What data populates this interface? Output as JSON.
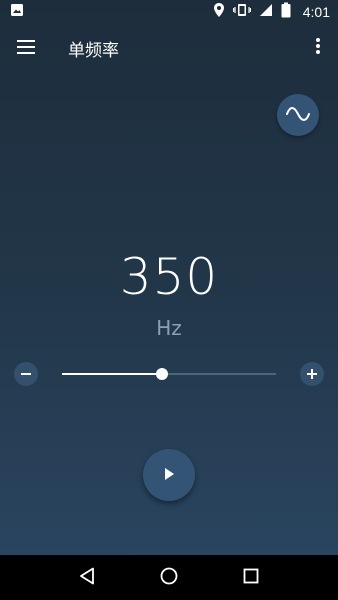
{
  "status_bar": {
    "time": "4:01",
    "icons": [
      "image-icon",
      "location-icon",
      "vibrate-icon",
      "signal-icon",
      "battery-icon"
    ]
  },
  "toolbar": {
    "title": "单频率",
    "menu_icon": "hamburger-menu-icon",
    "more_icon": "more-vert-icon"
  },
  "waveform": {
    "icon": "sine-wave-icon"
  },
  "frequency": {
    "value": "350",
    "unit": "Hz"
  },
  "slider": {
    "position_fraction": 0.465,
    "minus_icon": "minus-icon",
    "plus_icon": "plus-icon"
  },
  "player": {
    "icon": "play-icon"
  },
  "nav": {
    "back_icon": "back-icon",
    "home_icon": "home-icon",
    "recents_icon": "recents-icon"
  },
  "colors": {
    "background_top": "#1d2d3c",
    "background_bottom": "#2a4560",
    "button": "#335474",
    "unit_text": "#8aa0b2"
  }
}
